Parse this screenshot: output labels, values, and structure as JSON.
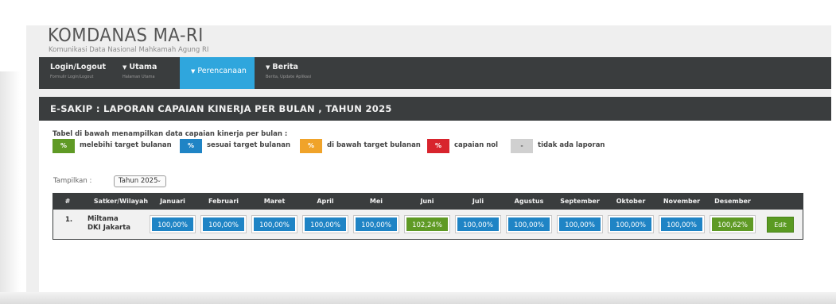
{
  "site": {
    "title": "KOMDANAS MA-RI",
    "subtitle": "Komunikasi Data Nasional Mahkamah Agung RI"
  },
  "nav": [
    {
      "label": "Login/Logout",
      "sub": "Formulir Login/Logout",
      "caret": "",
      "active": false
    },
    {
      "label": "Utama",
      "sub": "Halaman Utama",
      "caret": "▼",
      "active": false
    },
    {
      "label": "Perencanaan",
      "sub": "",
      "caret": "▼",
      "active": true
    },
    {
      "label": "Berita",
      "sub": "Berita, Update Aplikasi",
      "caret": "▼",
      "active": false
    }
  ],
  "page_title": "E-SAKIP : LAPORAN CAPAIAN KINERJA PER BULAN , TAHUN 2025",
  "description": "Tabel di bawah menampilkan data capaian kinerja per bulan :",
  "legend": [
    {
      "symbol": "%",
      "label": "melebihi target bulanan",
      "color": "#5f9a25"
    },
    {
      "symbol": "%",
      "label": "sesuai target bulanan",
      "color": "#1f84c5"
    },
    {
      "symbol": "%",
      "label": "di bawah target bulanan",
      "color": "#f0a32a"
    },
    {
      "symbol": "%",
      "label": "capaian nol",
      "color": "#d8242d"
    },
    {
      "symbol": "-",
      "label": "tidak ada laporan",
      "color": "#d0d0d0"
    }
  ],
  "filter": {
    "label": "Tampilkan :",
    "selected": "Tahun 2025"
  },
  "table": {
    "headers": [
      "#",
      "Satker/Wilayah",
      "Januari",
      "Februari",
      "Maret",
      "April",
      "Mei",
      "Juni",
      "Juli",
      "Agustus",
      "September",
      "Oktober",
      "November",
      "Desember"
    ],
    "rows": [
      {
        "no": "1.",
        "satker_line1": "Miltama",
        "satker_line2": "DKI Jakarta",
        "values": [
          "100,00%",
          "100,00%",
          "100,00%",
          "100,00%",
          "100,00%",
          "102,24%",
          "100,00%",
          "100,00%",
          "100,00%",
          "100,00%",
          "100,00%",
          "100,62%"
        ],
        "status": [
          "blue",
          "blue",
          "blue",
          "blue",
          "blue",
          "green",
          "blue",
          "blue",
          "blue",
          "blue",
          "blue",
          "green"
        ],
        "action": "Edit"
      }
    ]
  }
}
